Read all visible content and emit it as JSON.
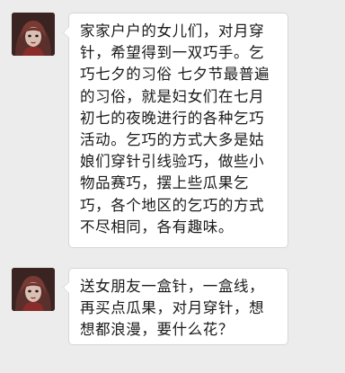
{
  "messages": [
    {
      "sender": "other",
      "avatar_icon": "user-avatar-icon",
      "text": "家家户户的女儿们，对月穿针，希望得到一双巧手。乞巧七夕的习俗 七夕节最普遍的习俗，就是妇女们在七月初七的夜晚进行的各种乞巧活动。乞巧的方式大多是姑娘们穿针引线验巧，做些小物品赛巧，摆上些瓜果乞巧，各个地区的乞巧的方式不尽相同，各有趣味。"
    },
    {
      "sender": "other",
      "avatar_icon": "user-avatar-icon",
      "text": "送女朋友一盒针，一盒线，再买点瓜果，对月穿针，想想都浪漫，要什么花？"
    }
  ],
  "colors": {
    "background": "#ececec",
    "bubble": "#ffffff",
    "bubble_border": "#d6d6d6",
    "text": "#1a1a1a"
  }
}
